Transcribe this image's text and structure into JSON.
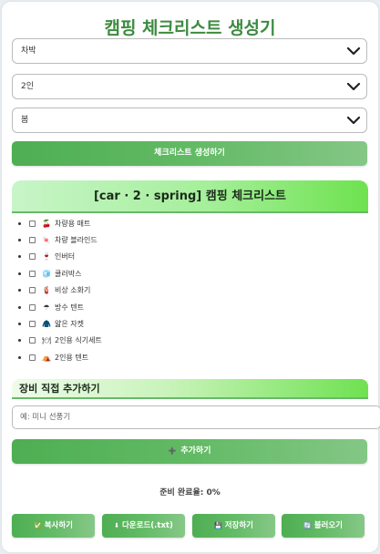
{
  "header": {
    "title": "캠핑 체크리스트 생성기"
  },
  "selects": {
    "transport": "차박",
    "people": "2인",
    "season": "봄"
  },
  "generate_button": "체크리스트 생성하기",
  "checklist": {
    "title": "[car · 2 · spring] 캠핑 체크리스트",
    "items": [
      {
        "icon": "🍒",
        "label": "차량용 매트"
      },
      {
        "icon": "🍬",
        "label": "차량 블라인드"
      },
      {
        "icon": "🍷",
        "label": "인버터"
      },
      {
        "icon": "🧊",
        "label": "쿨러박스"
      },
      {
        "icon": "🧯",
        "label": "비상 소화기"
      },
      {
        "icon": "☂",
        "label": "방수 텐트"
      },
      {
        "icon": "🧥",
        "label": "얇은 자켓"
      },
      {
        "icon": "🍽",
        "label": "2인용 식기세트"
      },
      {
        "icon": "⛺",
        "label": "2인용 텐트"
      }
    ]
  },
  "custom_section": {
    "title": "장비 직접 추가하기",
    "placeholder": "예: 미니 선풍기",
    "add_button": "추가하기",
    "add_icon": "➕"
  },
  "progress": {
    "text": "준비 완료율: 0%",
    "value": 0
  },
  "actions": {
    "copy": {
      "icon": "✅",
      "label": "복사하기"
    },
    "download": {
      "icon": "⬇",
      "label": "다운로드(.txt)"
    },
    "save": {
      "icon": "💾",
      "label": "저장하기"
    },
    "load": {
      "icon": "🔄",
      "label": "불러오기"
    }
  },
  "colors": {
    "accent": "#4caf50",
    "title": "#3d8b40",
    "header_gradient_end": "#6ee24f"
  }
}
